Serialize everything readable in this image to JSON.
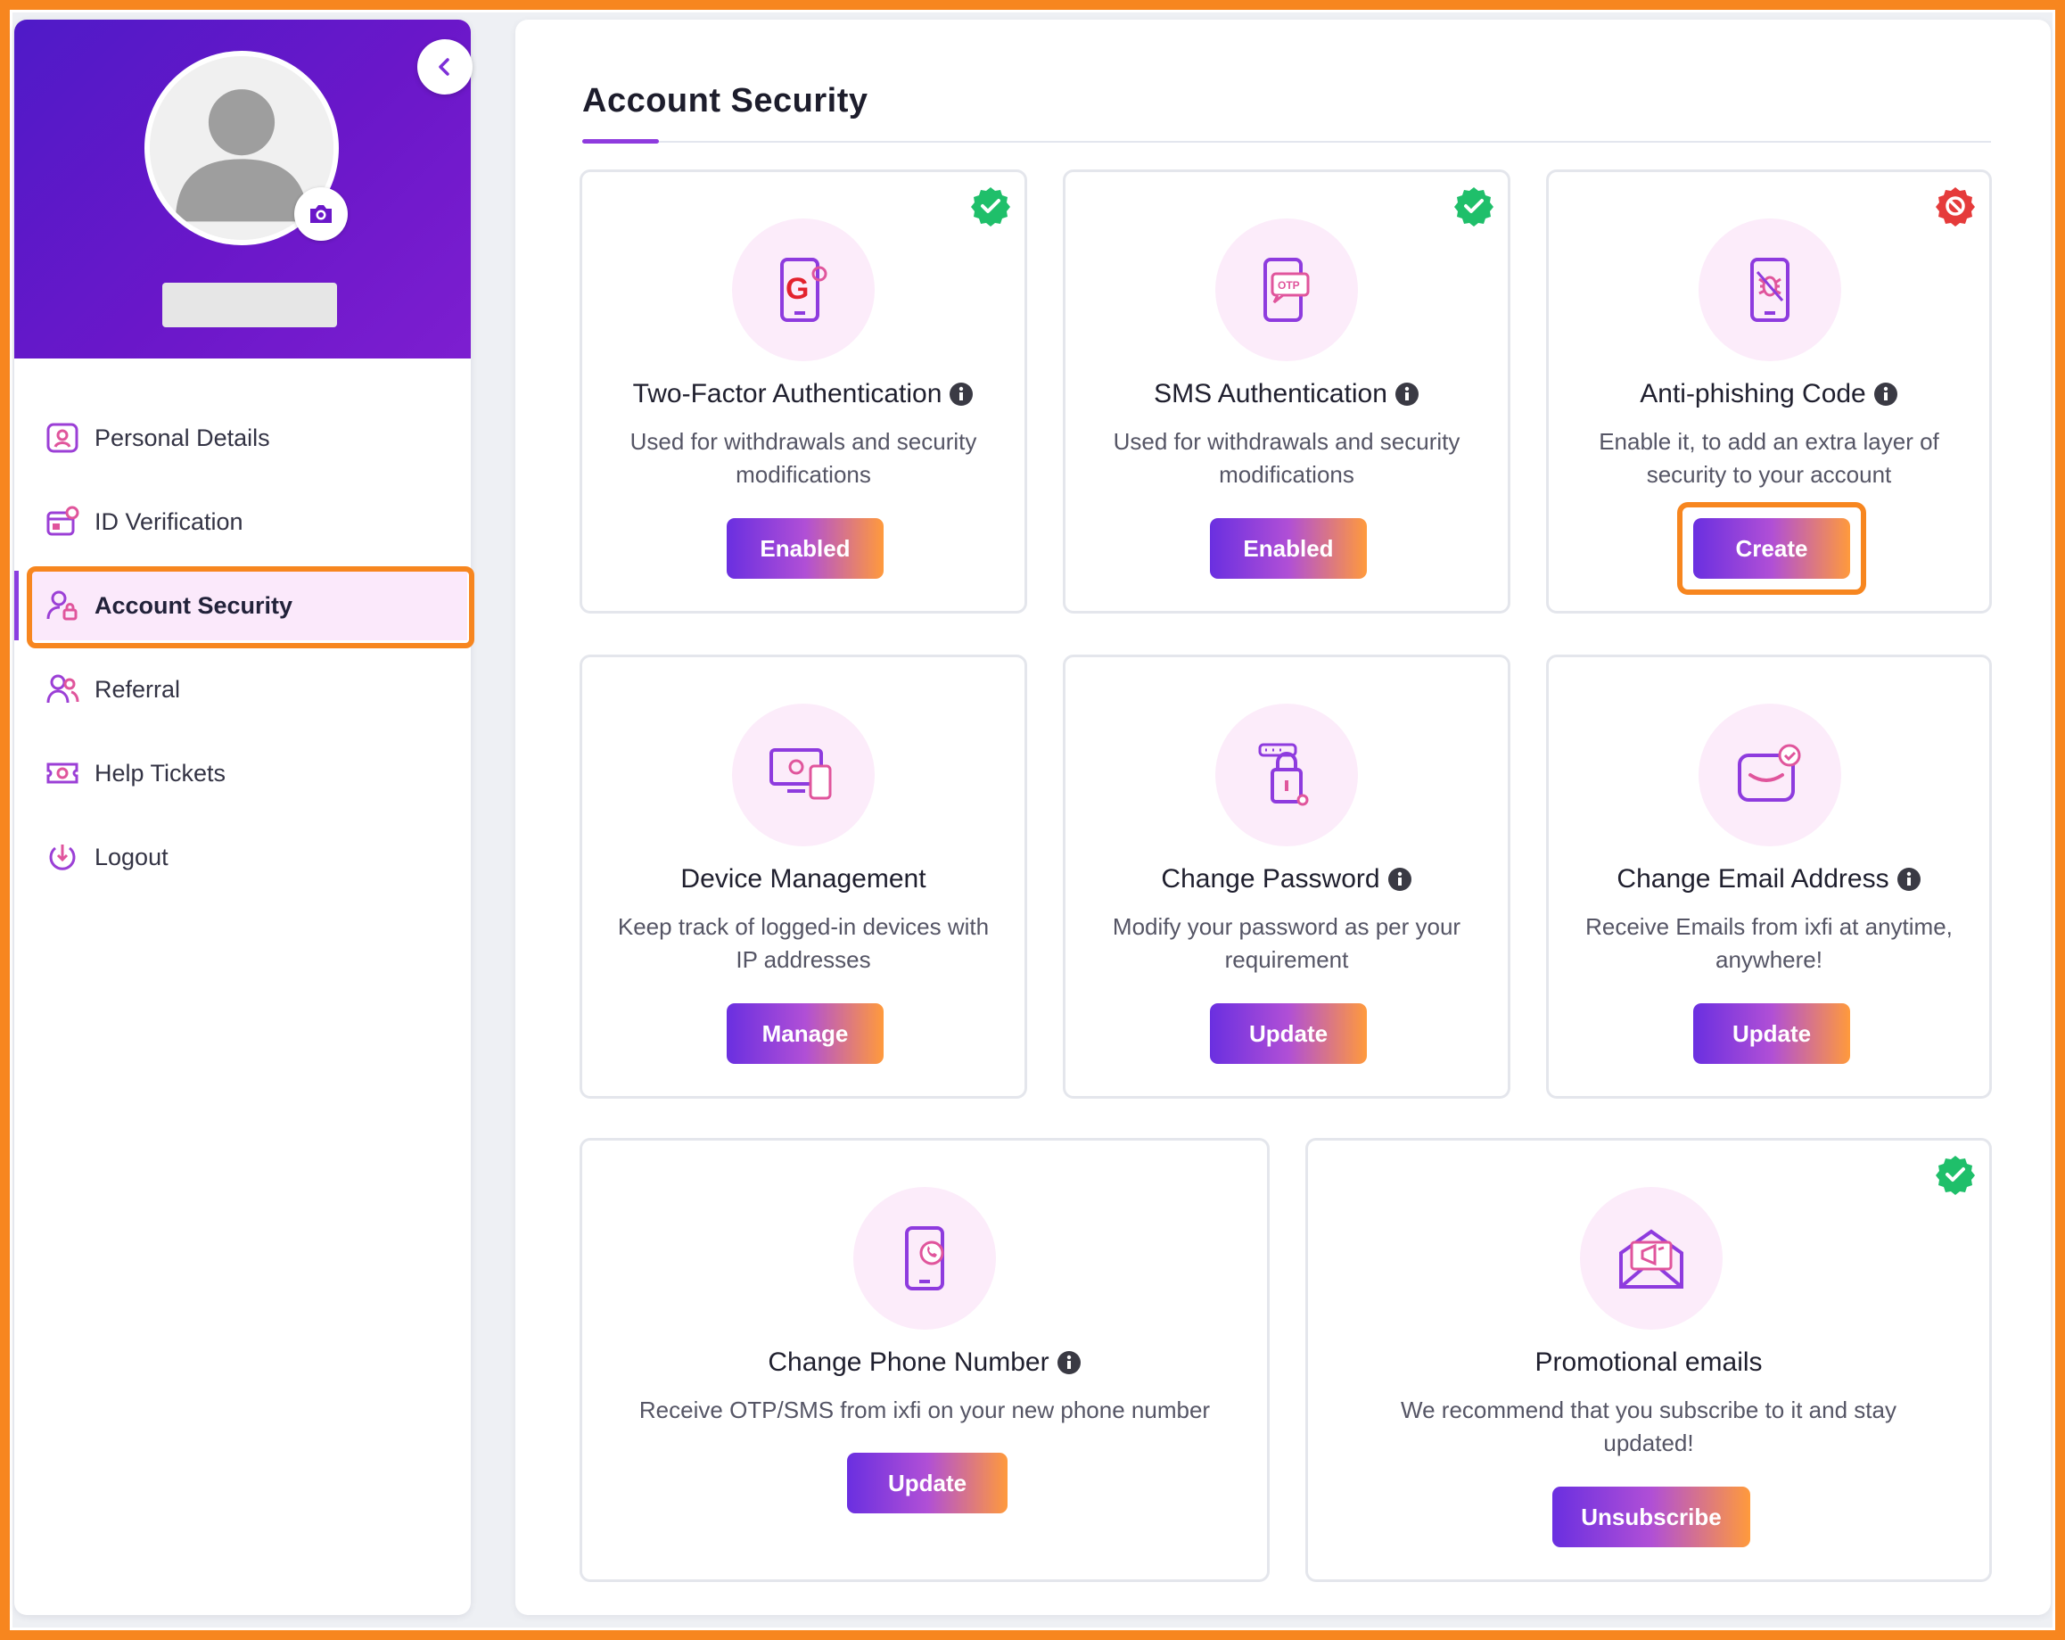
{
  "sidebar": {
    "items": [
      {
        "label": "Personal Details",
        "icon": "id-card-icon"
      },
      {
        "label": "ID Verification",
        "icon": "id-verify-icon"
      },
      {
        "label": "Account Security",
        "icon": "user-lock-icon",
        "active": true
      },
      {
        "label": "Referral",
        "icon": "users-icon"
      },
      {
        "label": "Help Tickets",
        "icon": "ticket-icon"
      },
      {
        "label": "Logout",
        "icon": "logout-icon"
      }
    ]
  },
  "main": {
    "title": "Account Security",
    "cards": [
      {
        "title": "Two-Factor Authentication",
        "desc": "Used for withdrawals and security modifications",
        "button": "Enabled",
        "status": "enabled",
        "icon": "google-authenticator-icon"
      },
      {
        "title": "SMS Authentication",
        "desc": "Used for withdrawals and security modifications",
        "button": "Enabled",
        "status": "enabled",
        "icon": "otp-message-icon",
        "icon_text": "OTP"
      },
      {
        "title": "Anti-phishing Code",
        "desc": "Enable it, to add an extra layer of security to your account",
        "button": "Create",
        "status": "disabled",
        "icon": "anti-phishing-icon"
      },
      {
        "title": "Device Management",
        "desc": "Keep track of logged-in devices with IP addresses",
        "button": "Manage",
        "icon": "devices-icon"
      },
      {
        "title": "Change Password",
        "desc": "Modify your password as per your requirement",
        "button": "Update",
        "icon": "password-lock-icon"
      },
      {
        "title": "Change Email Address",
        "desc": "Receive Emails from ixfi at anytime, anywhere!",
        "button": "Update",
        "icon": "email-icon"
      },
      {
        "title": "Change Phone Number",
        "desc": "Receive OTP/SMS from ixfi on your new phone number",
        "button": "Update",
        "icon": "phone-icon"
      },
      {
        "title": "Promotional emails",
        "desc": "We recommend that you subscribe to it and stay updated!",
        "button": "Unsubscribe",
        "status": "enabled",
        "icon": "promo-mail-icon"
      }
    ]
  },
  "colors": {
    "accent": "#8e3bde",
    "highlight": "#f7861f",
    "enabled_badge": "#1fbf6a",
    "disabled_badge": "#e53b3b"
  }
}
